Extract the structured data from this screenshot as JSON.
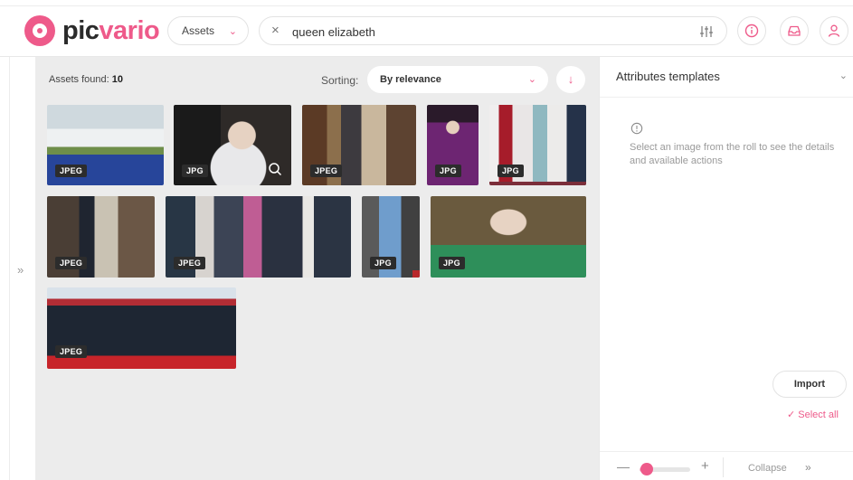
{
  "brand": {
    "name_prefix": "pic",
    "name_suffix": "vario",
    "accent": "#ee5a8a"
  },
  "header": {
    "scope_label": "Assets",
    "search_value": "queen elizabeth",
    "icons": [
      "close-icon",
      "filter-sliders-icon",
      "info-icon",
      "inbox-icon",
      "user-icon"
    ]
  },
  "results": {
    "found_label": "Assets found:",
    "found_count": "10",
    "sorting_label": "Sorting:",
    "sort_value": "By relevance",
    "sort_direction": "descending"
  },
  "assets": [
    {
      "format": "JPEG"
    },
    {
      "format": "JPG"
    },
    {
      "format": "JPEG"
    },
    {
      "format": "JPG"
    },
    {
      "format": "JPG"
    },
    {
      "format": "JPEG"
    },
    {
      "format": "JPEG"
    },
    {
      "format": "JPG"
    },
    {
      "format": "JPG"
    },
    {
      "format": "JPEG"
    }
  ],
  "panel": {
    "title": "Attributes templates",
    "hint": "Select an image from the roll to see the details and available actions",
    "import_label": "Import",
    "select_all_label": "Select all",
    "zoom_level": 0.15,
    "collapse_label": "Collapse"
  }
}
